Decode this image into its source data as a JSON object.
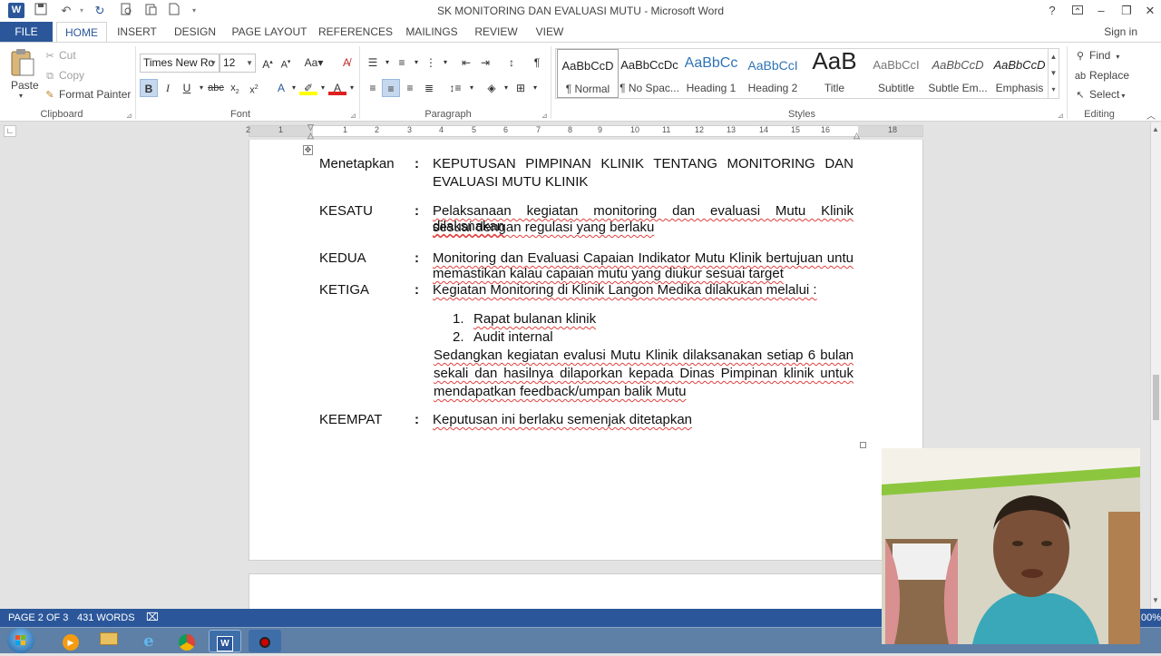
{
  "window": {
    "title": "SK MONITORING DAN EVALUASI MUTU - Microsoft Word",
    "help": "?",
    "minimize": "–",
    "restore": "❐",
    "close": "✕"
  },
  "tabs": {
    "file": "FILE",
    "items": [
      "HOME",
      "INSERT",
      "DESIGN",
      "PAGE LAYOUT",
      "REFERENCES",
      "MAILINGS",
      "REVIEW",
      "VIEW"
    ],
    "signin": "Sign in"
  },
  "clipboard": {
    "paste": "Paste",
    "cut": "Cut",
    "copy": "Copy",
    "format_painter": "Format Painter",
    "label": "Clipboard"
  },
  "font": {
    "family": "Times New Ro",
    "size": "12",
    "label": "Font"
  },
  "paragraph": {
    "label": "Paragraph"
  },
  "styles": {
    "label": "Styles",
    "items": [
      {
        "preview": "AaBbCcD",
        "name": "¶ Normal"
      },
      {
        "preview": "AaBbCcDc",
        "name": "¶ No Spac..."
      },
      {
        "preview": "AaBbCc",
        "name": "Heading 1"
      },
      {
        "preview": "AaBbCcI",
        "name": "Heading 2"
      },
      {
        "preview": "AaB",
        "name": "Title"
      },
      {
        "preview": "AaBbCcI",
        "name": "Subtitle"
      },
      {
        "preview": "AaBbCcD",
        "name": "Subtle Em..."
      },
      {
        "preview": "AaBbCcD",
        "name": "Emphasis"
      }
    ]
  },
  "editing": {
    "find": "Find",
    "replace": "Replace",
    "select": "Select",
    "label": "Editing"
  },
  "ruler": {
    "numbers": [
      "2",
      "1",
      "1",
      "2",
      "3",
      "4",
      "5",
      "6",
      "7",
      "8",
      "9",
      "10",
      "11",
      "12",
      "13",
      "14",
      "15",
      "16",
      "18"
    ]
  },
  "document": {
    "rows": [
      {
        "key": "Menetapkan",
        "lines": [
          "KEPUTUSAN PIMPINAN KLINIK TENTANG MONITORING DAN",
          "EVALUASI MUTU KLINIK"
        ]
      },
      {
        "key": "KESATU",
        "lines": [
          "Pelaksanaan kegiatan monitoring dan evaluasi Mutu Klinik dilaksnakan",
          "sesuai dengan regulasi yang berlaku"
        ]
      },
      {
        "key": "KEDUA",
        "lines": [
          "Monitoring dan Evaluasi Capaian Indikator  Mutu Klinik bertujuan untu",
          "memastikan kalau capaian  mutu yang  diukur  sesuai target"
        ]
      },
      {
        "key": "KETIGA",
        "lines": [
          "Kegiatan Monitoring di Klinik Langon Medika dilakukan melalui :"
        ]
      },
      {
        "key": "KEEMPAT",
        "lines": [
          "Keputusan ini berlaku semenjak ditetapkan"
        ]
      }
    ],
    "list": [
      {
        "num": "1.",
        "text": "Rapat bulanan klinik"
      },
      {
        "num": "2.",
        "text": "Audit internal"
      }
    ],
    "para": [
      "Sedangkan kegiatan evalusi Mutu Klinik dilaksanakan setiap 6 bulan",
      "sekali dan hasilnya dilaporkan kepada Dinas Pimpinan klinik  untuk",
      "mendapatkan feedback/umpan balik Mutu"
    ],
    "colon": ":"
  },
  "status": {
    "page": "PAGE 2 OF 3",
    "words": "431 WORDS",
    "zoom": "00%"
  }
}
